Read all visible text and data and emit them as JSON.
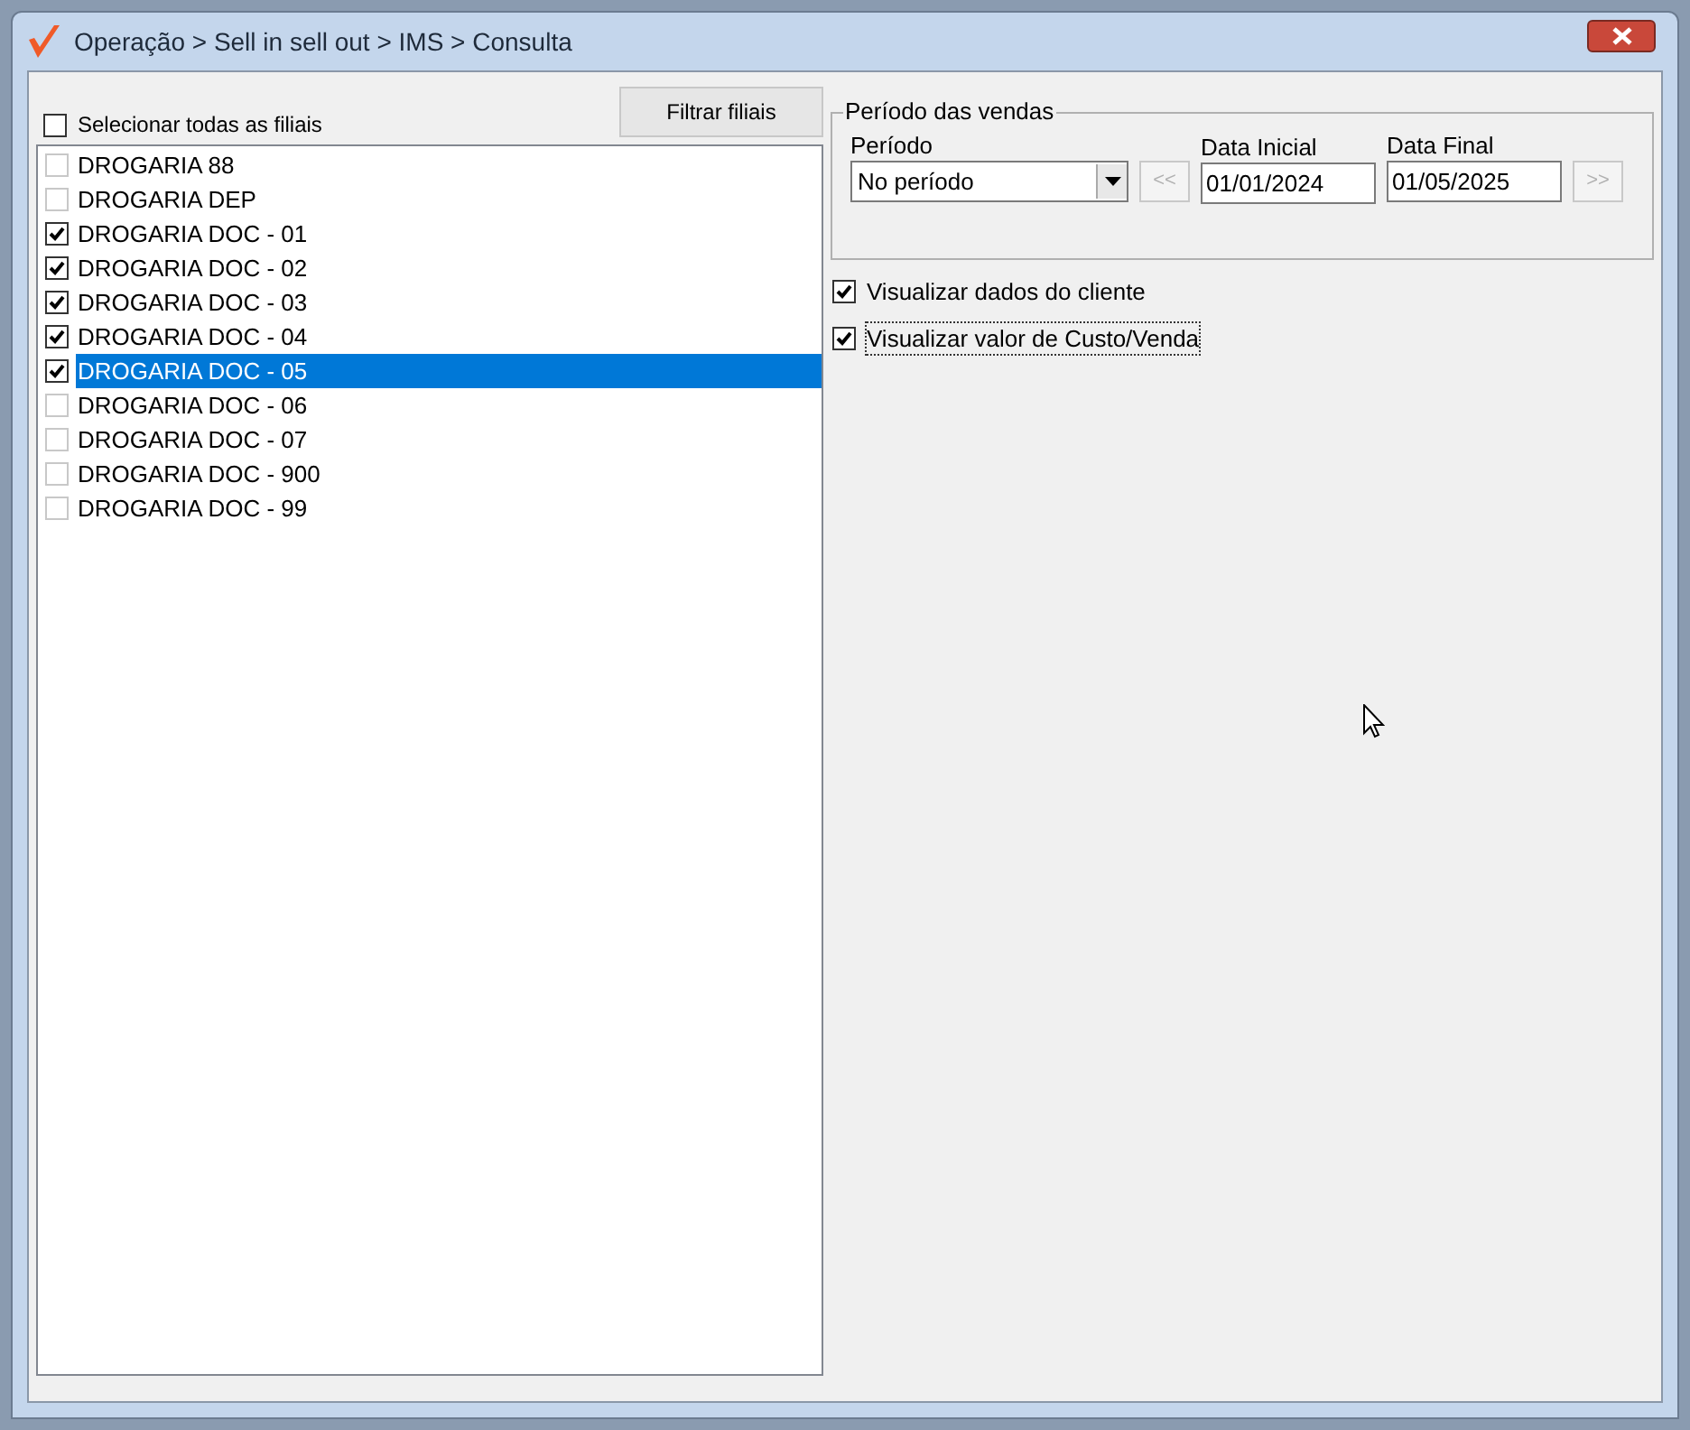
{
  "window": {
    "title": "Operação > Sell in sell out > IMS > Consulta"
  },
  "select_all": {
    "label": "Selecionar todas as filiais",
    "checked": false
  },
  "filter_button": "Filtrar filiais",
  "branches": [
    {
      "name": "DROGARIA 88",
      "checked": false,
      "selected": false
    },
    {
      "name": "DROGARIA DEP",
      "checked": false,
      "selected": false
    },
    {
      "name": "DROGARIA DOC - 01",
      "checked": true,
      "selected": false
    },
    {
      "name": "DROGARIA DOC - 02",
      "checked": true,
      "selected": false
    },
    {
      "name": "DROGARIA DOC - 03",
      "checked": true,
      "selected": false
    },
    {
      "name": "DROGARIA DOC - 04",
      "checked": true,
      "selected": false
    },
    {
      "name": "DROGARIA DOC - 05",
      "checked": true,
      "selected": true
    },
    {
      "name": "DROGARIA DOC - 06",
      "checked": false,
      "selected": false
    },
    {
      "name": "DROGARIA DOC - 07",
      "checked": false,
      "selected": false
    },
    {
      "name": "DROGARIA DOC - 900",
      "checked": false,
      "selected": false
    },
    {
      "name": "DROGARIA DOC - 99",
      "checked": false,
      "selected": false
    }
  ],
  "sales_period": {
    "title": "Período das vendas",
    "period_label": "Período",
    "period_value": "No período",
    "prev_button": "<<",
    "start_label": "Data Inicial",
    "start_value": "01/01/2024",
    "end_label": "Data Final",
    "end_value": "01/05/2025",
    "next_button": ">>"
  },
  "options": [
    {
      "label": "Visualizar dados do cliente",
      "checked": true,
      "focused": false
    },
    {
      "label": "Visualizar valor de Custo/Venda",
      "checked": true,
      "focused": true
    }
  ]
}
